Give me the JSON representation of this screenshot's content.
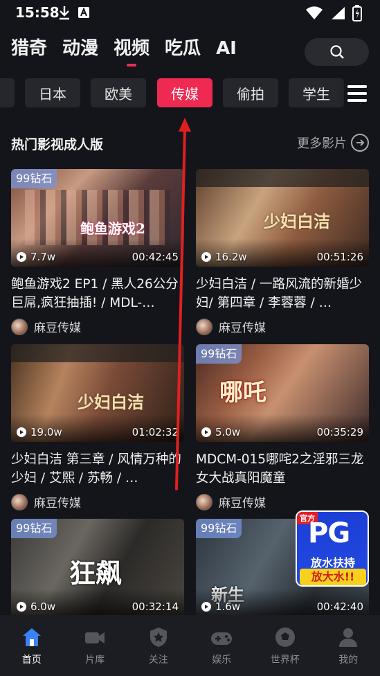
{
  "status": {
    "time": "15:58"
  },
  "top_nav": {
    "tabs": [
      {
        "label": "猎奇",
        "active": false
      },
      {
        "label": "动漫",
        "active": false
      },
      {
        "label": "视频",
        "active": true
      },
      {
        "label": "吃瓜",
        "active": false
      },
      {
        "label": "AI",
        "active": false
      }
    ]
  },
  "categories": [
    "…",
    "日本",
    "欧美",
    "传媒",
    "偷拍",
    "学生"
  ],
  "active_category": "传媒",
  "section": {
    "title": "热门影视成人版",
    "more_label": "更多影片"
  },
  "cards": [
    {
      "badge": "99钻石",
      "views": "7.7w",
      "duration": "00:42:45",
      "title": "鲍鱼游戏2 EP1 / 黑人26公分巨屌,疯狂抽插! / MDL-…",
      "author": "麻豆传媒",
      "thumb_text": "鲍鱼游戏2"
    },
    {
      "badge": "",
      "views": "16.2w",
      "duration": "00:51:26",
      "title": "少妇白洁 / 一路风流的新婚少妇/ 第四章 / 李蓉蓉 / …",
      "author": "麻豆传媒",
      "thumb_text": "少妇白洁"
    },
    {
      "badge": "",
      "views": "19.0w",
      "duration": "01:02:32",
      "title": "少妇白洁 第三章 / 风情万种的少妇 / 艾熙 / 苏畅 / …",
      "author": "麻豆传媒",
      "thumb_text": "少妇白洁"
    },
    {
      "badge": "99钻石",
      "views": "5.0w",
      "duration": "00:35:29",
      "title": "MDCM-015哪咤2之淫邪三龙女大战真阳魔童",
      "author": "麻豆传媒",
      "thumb_text": "哪吒"
    },
    {
      "badge": "99钻石",
      "views": "6.0w",
      "duration": "00:32:14",
      "title": "",
      "author": "",
      "thumb_text": "狂飙"
    },
    {
      "badge": "99钻石",
      "views": "1.6w",
      "duration": "00:42:40",
      "title": "",
      "author": "",
      "thumb_text": "新生"
    }
  ],
  "ad": {
    "corner": "官方",
    "brand": "PG",
    "line1": "放水扶持",
    "line2": "放大水!!"
  },
  "bottom_nav": {
    "items": [
      {
        "label": "首页",
        "icon": "home-icon",
        "active": true
      },
      {
        "label": "片库",
        "icon": "video-camera-icon",
        "active": false
      },
      {
        "label": "关注",
        "icon": "star-shield-icon",
        "active": false
      },
      {
        "label": "娱乐",
        "icon": "gamepad-icon",
        "active": false
      },
      {
        "label": "世界杯",
        "icon": "soccer-ball-icon",
        "active": false
      },
      {
        "label": "我的",
        "icon": "user-icon",
        "active": false
      }
    ]
  },
  "colors": {
    "accent": "#ee2a52",
    "background": "#14151a",
    "badge": "#7896dc",
    "annotation_arrow": "#e02020"
  }
}
